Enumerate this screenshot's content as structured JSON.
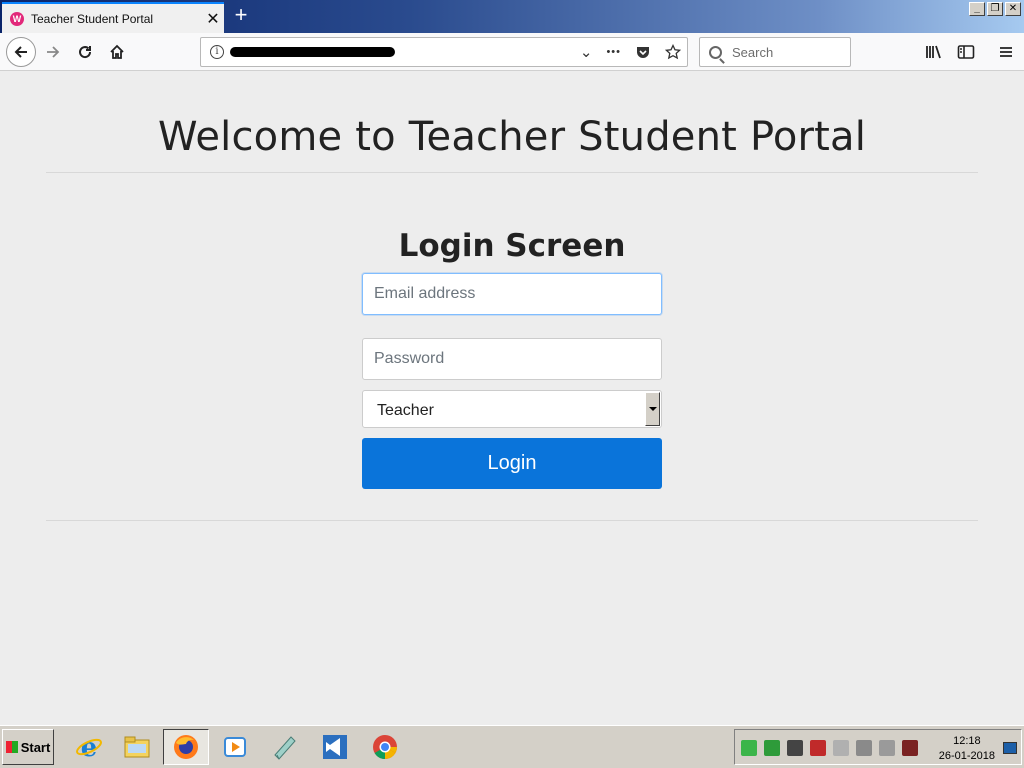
{
  "browser": {
    "tab_title": "Teacher Student Portal",
    "tab_close": "✕",
    "new_tab": "+",
    "window_buttons": [
      "_",
      "❐",
      "✕"
    ],
    "url_redacted": "redacted",
    "search_placeholder": "Search",
    "url_actions": [
      "⌄",
      "•••"
    ]
  },
  "page": {
    "title": "Welcome to Teacher Student Portal",
    "login_title": "Login Screen",
    "email_placeholder": "Email address",
    "password_placeholder": "Password",
    "role_selected": "Teacher",
    "login_button": "Login"
  },
  "taskbar": {
    "start_label": "Start",
    "clock_time": "12:18",
    "clock_date": "26-01-2018"
  },
  "colors": {
    "primary_button": "#0a74da",
    "focus_border": "#80bdff"
  }
}
